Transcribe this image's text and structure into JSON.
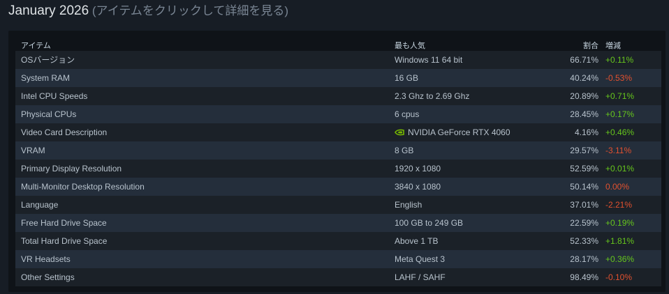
{
  "heading": {
    "month": "January 2026",
    "hint": " (アイテムをクリックして詳細を見る)"
  },
  "table": {
    "headers": {
      "item": "アイテム",
      "popular": "最も人気",
      "percent": "割合",
      "change": "増減"
    },
    "rows": [
      {
        "item": "OSバージョン",
        "popular": "Windows 11 64 bit",
        "percent": "66.71%",
        "change": "+0.11%",
        "trend": "pos"
      },
      {
        "item": "System RAM",
        "popular": "16 GB",
        "percent": "40.24%",
        "change": "-0.53%",
        "trend": "neg"
      },
      {
        "item": "Intel CPU Speeds",
        "popular": "2.3 Ghz to 2.69 Ghz",
        "percent": "20.89%",
        "change": "+0.71%",
        "trend": "pos"
      },
      {
        "item": "Physical CPUs",
        "popular": "6 cpus",
        "percent": "28.45%",
        "change": "+0.17%",
        "trend": "pos"
      },
      {
        "item": "Video Card Description",
        "popular": "NVIDIA GeForce RTX 4060",
        "percent": "4.16%",
        "change": "+0.46%",
        "trend": "pos",
        "icon": "nvidia-logo-icon"
      },
      {
        "item": "VRAM",
        "popular": "8 GB",
        "percent": "29.57%",
        "change": "-3.11%",
        "trend": "neg"
      },
      {
        "item": "Primary Display Resolution",
        "popular": "1920 x 1080",
        "percent": "52.59%",
        "change": "+0.01%",
        "trend": "pos"
      },
      {
        "item": "Multi-Monitor Desktop Resolution",
        "popular": "3840 x 1080",
        "percent": "50.14%",
        "change": "0.00%",
        "trend": "zero"
      },
      {
        "item": "Language",
        "popular": "English",
        "percent": "37.01%",
        "change": "-2.21%",
        "trend": "neg"
      },
      {
        "item": "Free Hard Drive Space",
        "popular": "100 GB to 249 GB",
        "percent": "22.59%",
        "change": "+0.19%",
        "trend": "pos"
      },
      {
        "item": "Total Hard Drive Space",
        "popular": "Above 1 TB",
        "percent": "52.33%",
        "change": "+1.81%",
        "trend": "pos"
      },
      {
        "item": "VR Headsets",
        "popular": "Meta Quest 3",
        "percent": "28.17%",
        "change": "+0.36%",
        "trend": "pos"
      },
      {
        "item": "Other Settings",
        "popular": "LAHF / SAHF",
        "percent": "98.49%",
        "change": "-0.10%",
        "trend": "neg"
      }
    ]
  },
  "colors": {
    "background": "#171d25",
    "panel": "#0f1318",
    "row_even": "#1b2128",
    "row_odd": "#242e3b",
    "positive": "#66c61c",
    "negative": "#e2512f",
    "nvidia_green": "#76b900"
  }
}
